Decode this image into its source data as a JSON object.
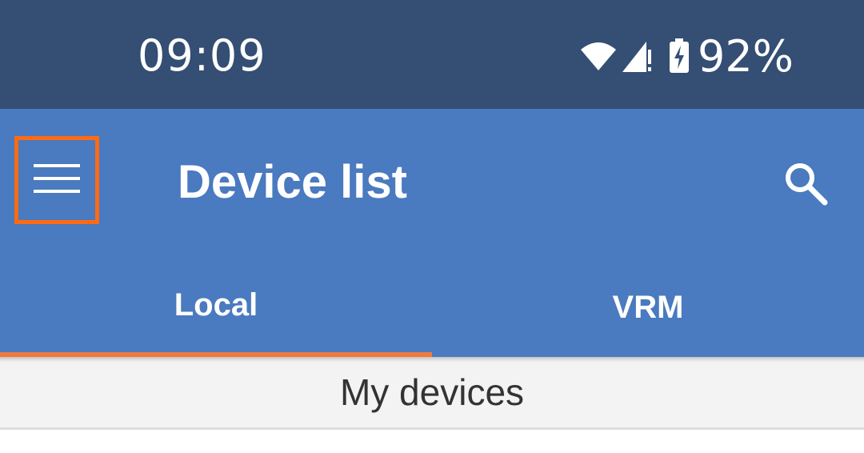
{
  "status_bar": {
    "time": "09:09",
    "battery_percent": "92%",
    "icons": [
      "wifi-icon",
      "signal-icon",
      "battery-charging-icon"
    ]
  },
  "app_bar": {
    "title": "Device list",
    "menu_icon": "hamburger-menu-icon",
    "search_icon": "search-icon"
  },
  "tabs": [
    {
      "label": "Local",
      "selected": true
    },
    {
      "label": "VRM",
      "selected": false
    }
  ],
  "section": {
    "title": "My devices"
  },
  "colors": {
    "status_bar": "#344e74",
    "app_bar": "#4a7abf",
    "tab_indicator": "#f07a3f",
    "highlight_box": "#ff6a13"
  }
}
